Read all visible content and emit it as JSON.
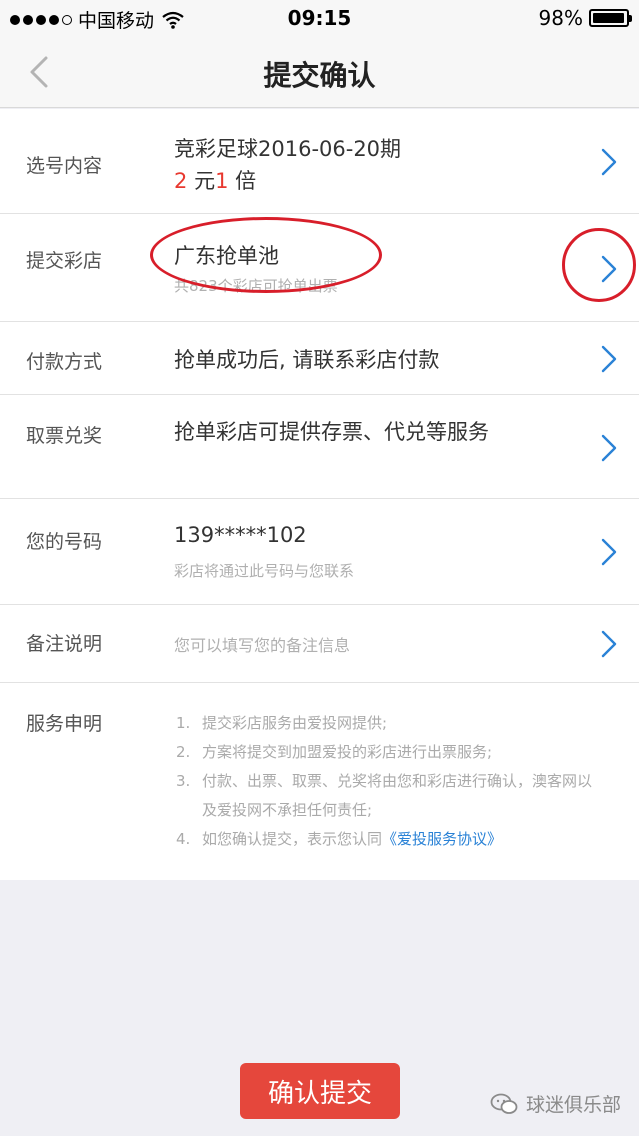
{
  "status_bar": {
    "carrier": "中国移动",
    "time": "09:15",
    "battery": "98%",
    "battery_level": 0.98,
    "signal_bars_filled": 4,
    "signal_bars_total": 5
  },
  "nav": {
    "title": "提交确认",
    "back_icon": "chevron-left-icon"
  },
  "rows": {
    "selection": {
      "label": "选号内容",
      "title": "竞彩足球2016-06-20期",
      "amount": "2",
      "yuan": "元",
      "multiple": "1",
      "bei": "倍"
    },
    "store": {
      "label": "提交彩店",
      "value": "广东抢单池",
      "sub": "共823个彩店可抢单出票"
    },
    "payment": {
      "label": "付款方式",
      "value": "抢单成功后, 请联系彩店付款"
    },
    "ticket": {
      "label": "取票兑奖",
      "value": "抢单彩店可提供存票、代兑等服务"
    },
    "phone": {
      "label": "您的号码",
      "value": "139*****102",
      "sub": "彩店将通过此号码与您联系"
    },
    "remark": {
      "label": "备注说明",
      "placeholder": "您可以填写您的备注信息"
    },
    "statement": {
      "label": "服务申明",
      "items": [
        {
          "num": "1.",
          "text": "提交彩店服务由爱投网提供;"
        },
        {
          "num": "2.",
          "text": "方案将提交到加盟爱投的彩店进行出票服务;"
        },
        {
          "num": "3.",
          "text": "付款、出票、取票、兑奖将由您和彩店进行确认，澳客网以及爱投网不承担任何责任;"
        },
        {
          "num": "4.",
          "text_before": "如您确认提交，表示您认同",
          "link": "《爱投服务协议》"
        }
      ]
    }
  },
  "confirm_button": "确认提交",
  "watermark": "球迷俱乐部",
  "colors": {
    "accent_red": "#e5473c",
    "link_blue": "#2a82d6",
    "chevron_blue": "#2a82d6",
    "annotation_red": "#d81e2a"
  }
}
